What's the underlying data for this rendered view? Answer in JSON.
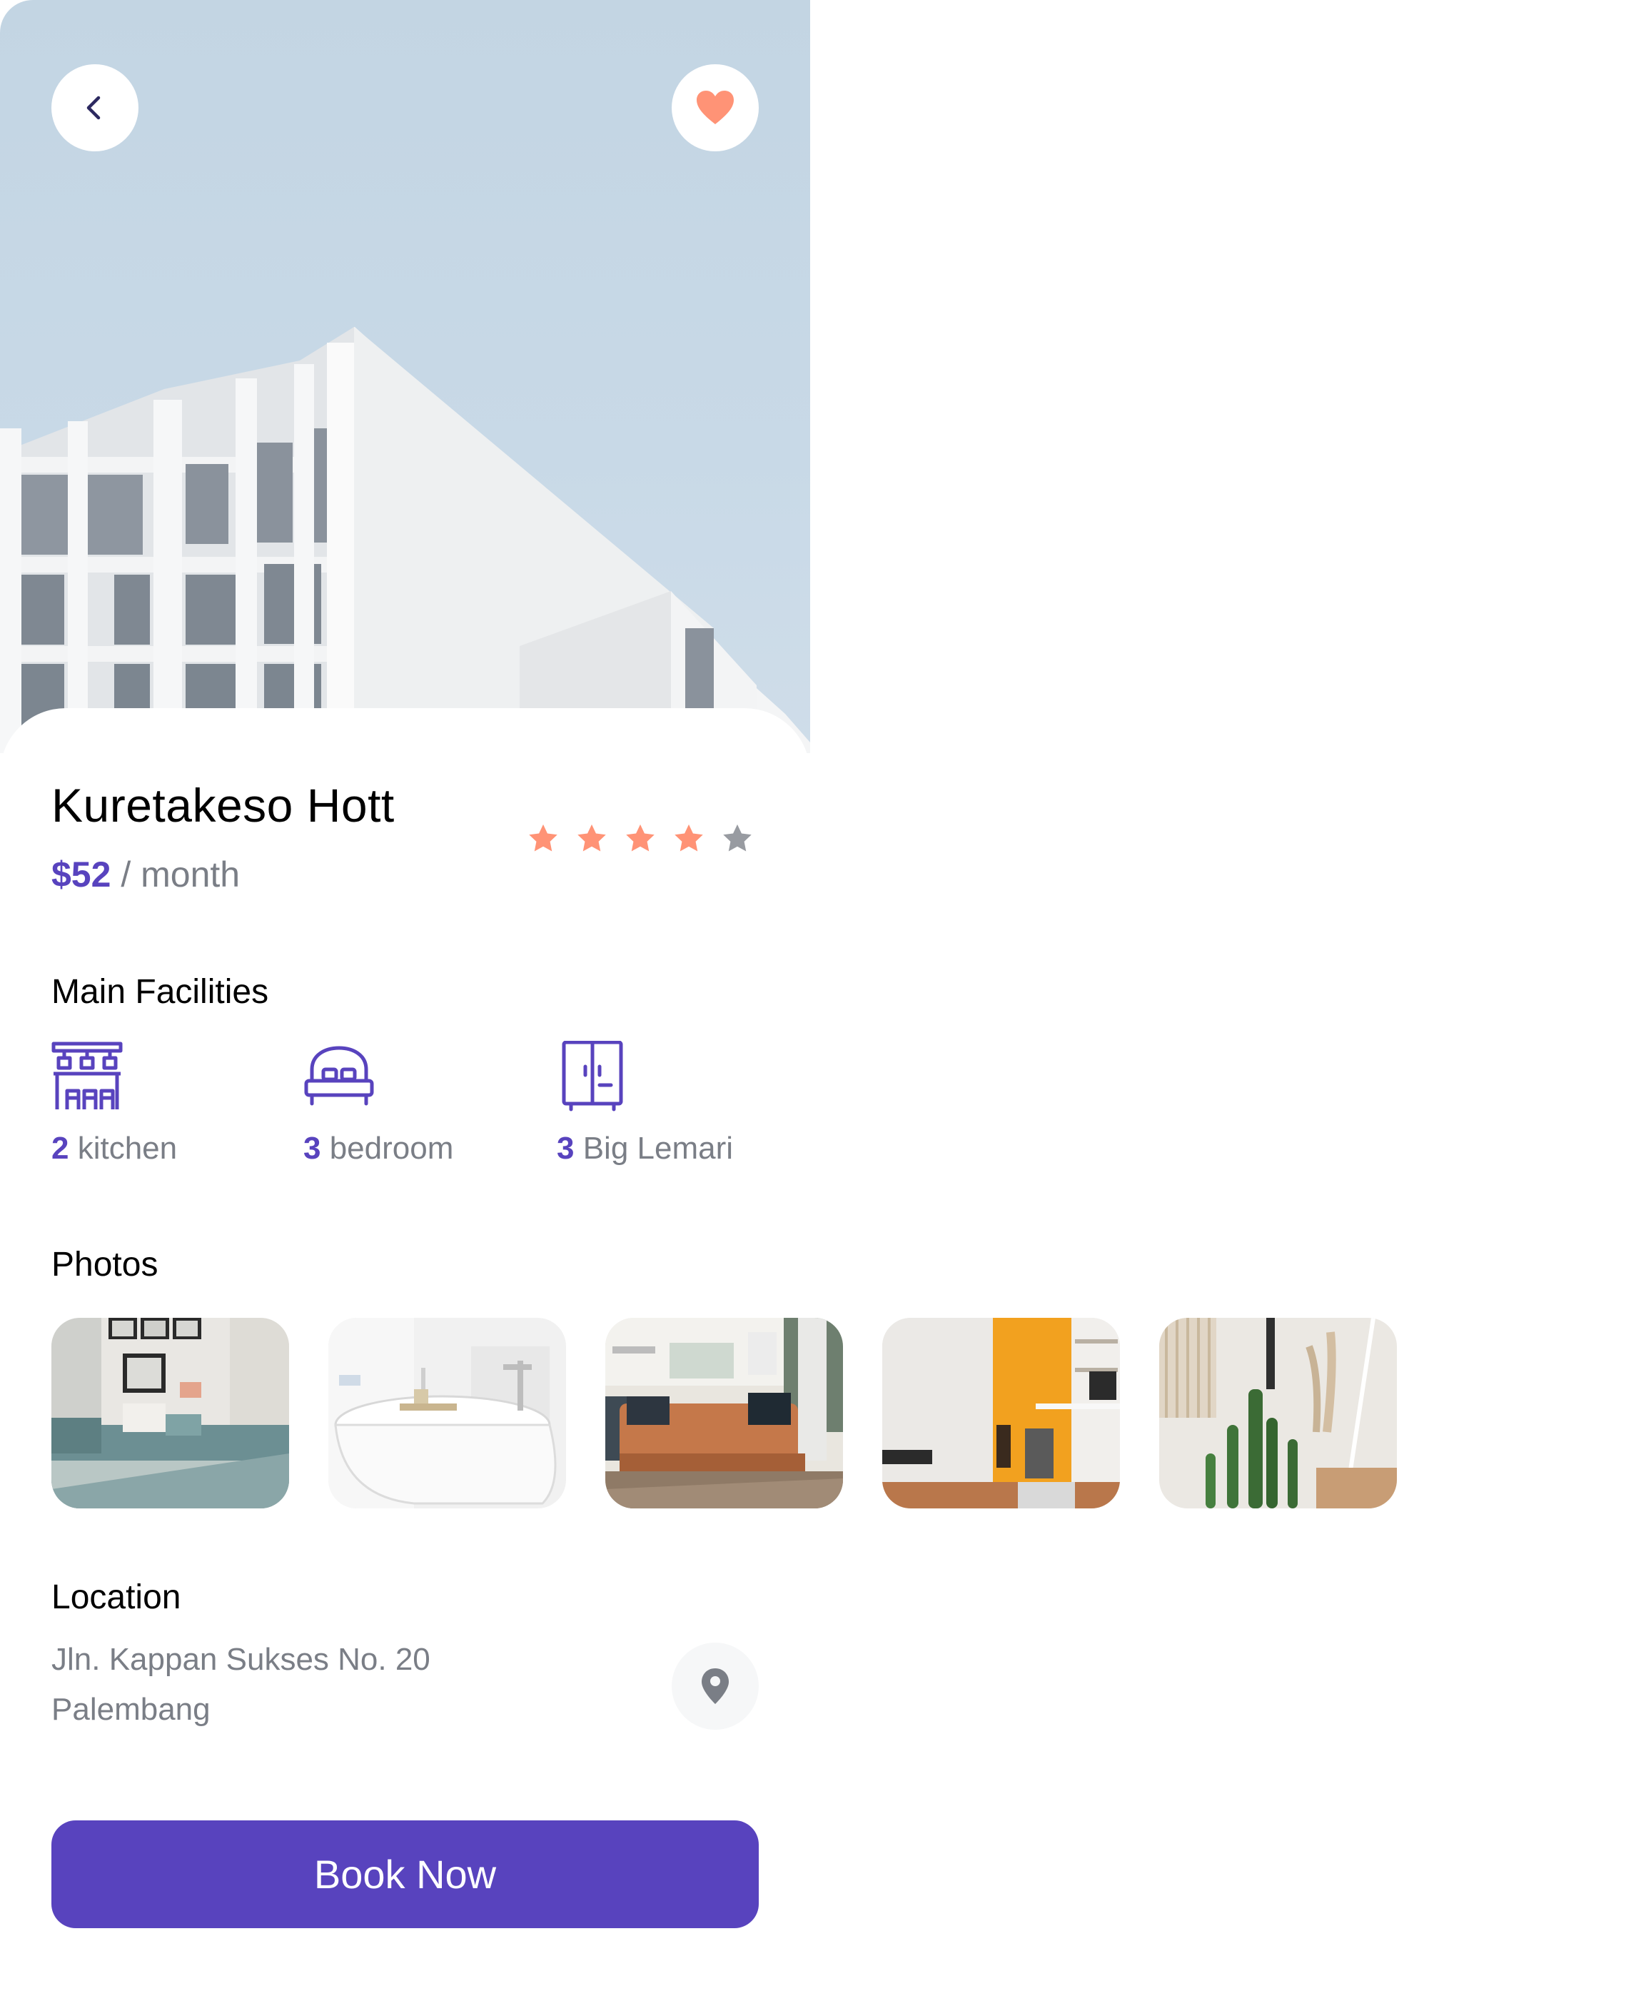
{
  "colors": {
    "primary": "#5843be",
    "accent_orange": "#ff9376",
    "muted_star": "#989ba1",
    "grey_text": "#7a7e86",
    "sky": "#c3d5e3"
  },
  "header": {
    "back_icon": "chevron-left-icon",
    "favorite_icon": "heart-icon"
  },
  "property": {
    "name": "Kuretakeso Hott",
    "price": "$52",
    "price_period": " / month",
    "rating": 4,
    "rating_max": 5
  },
  "facilities": {
    "title": "Main Facilities",
    "items": [
      {
        "icon": "kitchen-icon",
        "count": "2",
        "label": " kitchen"
      },
      {
        "icon": "bedroom-icon",
        "count": "3",
        "label": " bedroom"
      },
      {
        "icon": "cupboard-icon",
        "count": "3",
        "label": " Big Lemari"
      }
    ]
  },
  "photos": {
    "title": "Photos",
    "items": [
      "bedroom-photo",
      "bathtub-photo",
      "living-room-photo",
      "workspace-photo",
      "cactus-photo"
    ]
  },
  "location": {
    "title": "Location",
    "address_line1": "Jln. Kappan Sukses No. 20",
    "address_line2": "Palembang",
    "pin_icon": "map-pin-icon"
  },
  "actions": {
    "book_label": "Book Now"
  }
}
